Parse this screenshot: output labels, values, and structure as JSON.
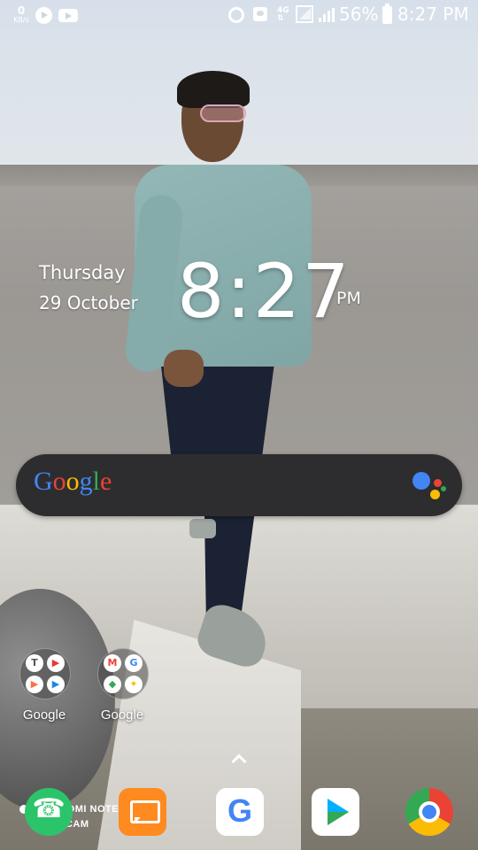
{
  "status_bar": {
    "net_speed_value": "0",
    "net_speed_unit": "KB/s",
    "network_type": "4G",
    "battery_percent": "56%",
    "time": "8:27 PM",
    "icons": [
      "youtube-play-icon",
      "youtube-icon",
      "alarm-icon",
      "notification-icon",
      "lte-icon",
      "signal-icon",
      "signal-icon",
      "battery-icon"
    ]
  },
  "clock_widget": {
    "day": "Thursday",
    "date": "29 October",
    "time": "8:27",
    "ampm": "PM"
  },
  "search_bar": {
    "logo_text": "Google",
    "assistant_icon": "google-assistant-icon"
  },
  "folders": [
    {
      "label": "Google",
      "apps": [
        "T",
        "▶",
        "▶",
        "▶"
      ]
    },
    {
      "label": "Google",
      "apps": [
        "M",
        "G",
        "◆",
        "✦"
      ]
    }
  ],
  "wallpaper_text": {
    "line1": "REDMI NOTE",
    "line2": "QUAD CAM"
  },
  "dock": [
    {
      "name": "phone-app",
      "icon": "phone-icon"
    },
    {
      "name": "messages-app",
      "icon": "messages-icon"
    },
    {
      "name": "google-app",
      "icon": "google-icon",
      "letter": "G"
    },
    {
      "name": "play-store-app",
      "icon": "play-store-icon"
    },
    {
      "name": "chrome-app",
      "icon": "chrome-icon"
    }
  ],
  "colors": {
    "google_blue": "#4285f4",
    "google_red": "#ea4335",
    "google_yellow": "#fbbc05",
    "google_green": "#34a853",
    "search_bar_bg": "#2d2d2f"
  }
}
